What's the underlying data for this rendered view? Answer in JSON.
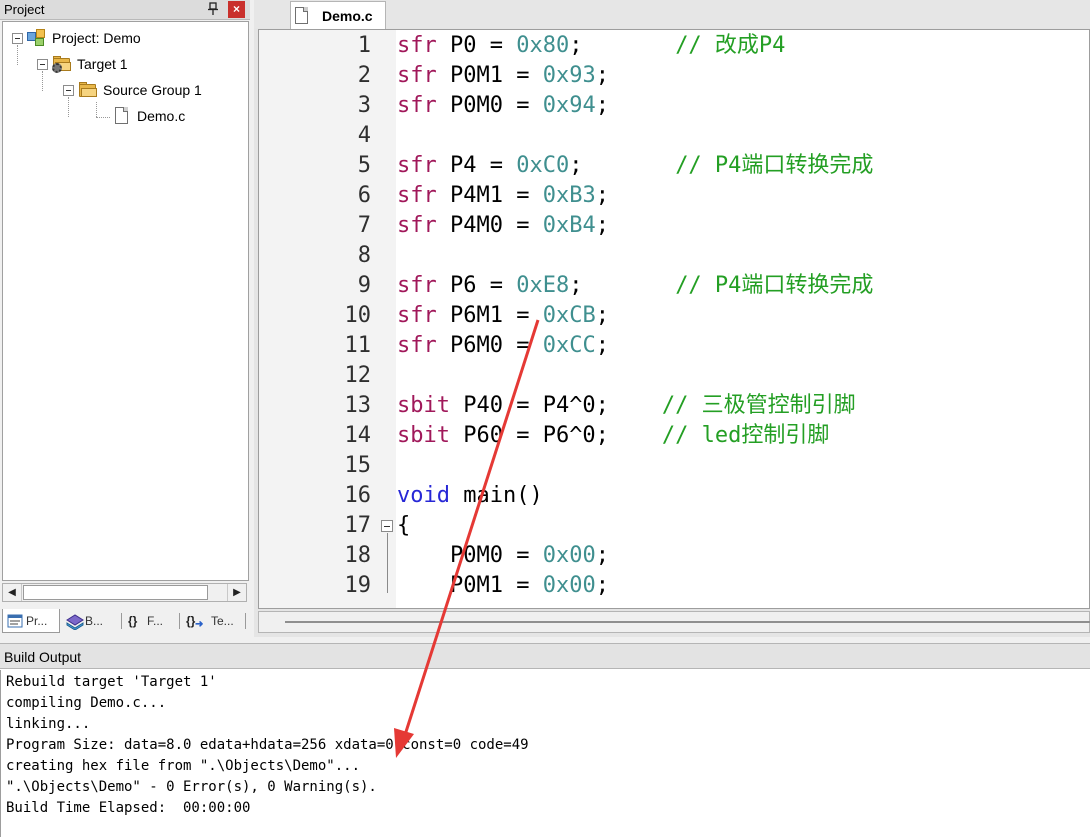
{
  "project_panel": {
    "title": "Project",
    "pin_glyph": "―",
    "close_glyph": "×",
    "tree": [
      {
        "label": "Project: Demo",
        "icon": "project-icon"
      },
      {
        "label": "Target 1",
        "icon": "target-icon"
      },
      {
        "label": "Source Group 1",
        "icon": "folder-icon"
      },
      {
        "label": "Demo.c",
        "icon": "file-icon"
      }
    ],
    "tabs": [
      {
        "label": "Pr...",
        "icon": "project-tab-icon"
      },
      {
        "label": "B...",
        "icon": "books-tab-icon"
      },
      {
        "label": "F...",
        "icon": "functions-tab-icon",
        "glyph": "{}"
      },
      {
        "label": "Te...",
        "icon": "templates-tab-icon",
        "glyph": "{}"
      }
    ]
  },
  "editor": {
    "tab_label": "Demo.c",
    "lines": [
      {
        "no": "1",
        "tokens": [
          [
            "kw",
            "sfr"
          ],
          [
            "t",
            " P0 = "
          ],
          [
            "num",
            "0x80"
          ],
          [
            "t",
            ";       "
          ],
          [
            "cmt",
            "// 改成P4"
          ]
        ]
      },
      {
        "no": "2",
        "tokens": [
          [
            "kw",
            "sfr"
          ],
          [
            "t",
            " P0M1 = "
          ],
          [
            "num",
            "0x93"
          ],
          [
            "t",
            ";"
          ]
        ]
      },
      {
        "no": "3",
        "tokens": [
          [
            "kw",
            "sfr"
          ],
          [
            "t",
            " P0M0 = "
          ],
          [
            "num",
            "0x94"
          ],
          [
            "t",
            ";"
          ]
        ]
      },
      {
        "no": "4",
        "tokens": []
      },
      {
        "no": "5",
        "tokens": [
          [
            "kw",
            "sfr"
          ],
          [
            "t",
            " P4 = "
          ],
          [
            "num",
            "0xC0"
          ],
          [
            "t",
            ";       "
          ],
          [
            "cmt",
            "// P4端口转换完成"
          ]
        ]
      },
      {
        "no": "6",
        "tokens": [
          [
            "kw",
            "sfr"
          ],
          [
            "t",
            " P4M1 = "
          ],
          [
            "num",
            "0xB3"
          ],
          [
            "t",
            ";"
          ]
        ]
      },
      {
        "no": "7",
        "tokens": [
          [
            "kw",
            "sfr"
          ],
          [
            "t",
            " P4M0 = "
          ],
          [
            "num",
            "0xB4"
          ],
          [
            "t",
            ";"
          ]
        ]
      },
      {
        "no": "8",
        "tokens": []
      },
      {
        "no": "9",
        "tokens": [
          [
            "kw",
            "sfr"
          ],
          [
            "t",
            " P6 = "
          ],
          [
            "num",
            "0xE8"
          ],
          [
            "t",
            ";       "
          ],
          [
            "cmt",
            "// P4端口转换完成"
          ]
        ]
      },
      {
        "no": "10",
        "tokens": [
          [
            "kw",
            "sfr"
          ],
          [
            "t",
            " P6M1 = "
          ],
          [
            "num",
            "0xCB"
          ],
          [
            "t",
            ";"
          ]
        ]
      },
      {
        "no": "11",
        "tokens": [
          [
            "kw",
            "sfr"
          ],
          [
            "t",
            " P6M0 = "
          ],
          [
            "num",
            "0xCC"
          ],
          [
            "t",
            ";"
          ]
        ]
      },
      {
        "no": "12",
        "tokens": []
      },
      {
        "no": "13",
        "tokens": [
          [
            "kw",
            "sbit"
          ],
          [
            "t",
            " P40 = P4^0;    "
          ],
          [
            "cmt",
            "// 三极管控制引脚"
          ]
        ]
      },
      {
        "no": "14",
        "tokens": [
          [
            "kw",
            "sbit"
          ],
          [
            "t",
            " P60 = P6^0;    "
          ],
          [
            "cmt",
            "// led控制引脚"
          ]
        ]
      },
      {
        "no": "15",
        "tokens": []
      },
      {
        "no": "16",
        "tokens": [
          [
            "kwv",
            "void"
          ],
          [
            "t",
            " main()"
          ]
        ]
      },
      {
        "no": "17",
        "tokens": [
          [
            "t",
            "{"
          ]
        ]
      },
      {
        "no": "18",
        "tokens": [
          [
            "t",
            "    P0M0 = "
          ],
          [
            "num",
            "0x00"
          ],
          [
            "t",
            ";"
          ]
        ]
      },
      {
        "no": "19",
        "tokens": [
          [
            "t",
            "    P0M1 = "
          ],
          [
            "num",
            "0x00"
          ],
          [
            "t",
            ";"
          ]
        ]
      }
    ]
  },
  "build": {
    "title": "Build Output",
    "lines": [
      "Rebuild target 'Target 1'",
      "compiling Demo.c...",
      "linking...",
      "Program Size: data=8.0 edata+hdata=256 xdata=0 const=0 code=49",
      "creating hex file from \".\\Objects\\Demo\"...",
      "\".\\Objects\\Demo\" - 0 Error(s), 0 Warning(s).",
      "Build Time Elapsed:  00:00:00"
    ]
  },
  "colors": {
    "keyword": "#a0185a",
    "void_keyword": "#2727d6",
    "number": "#3f8f8f",
    "comment": "#249f24",
    "annotation_arrow": "#e53935"
  }
}
